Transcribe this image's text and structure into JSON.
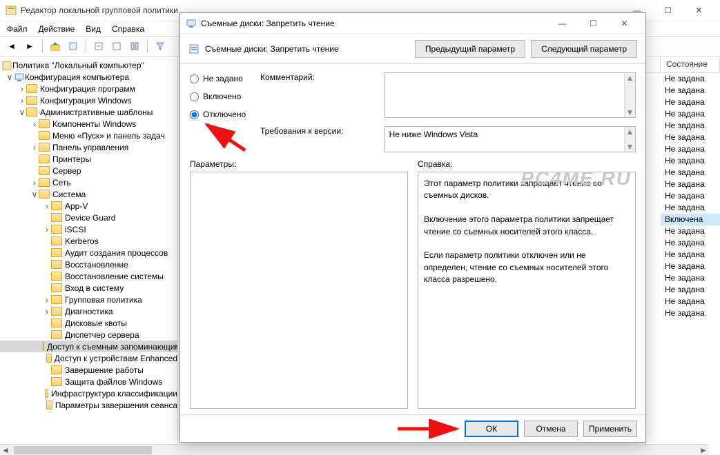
{
  "main_window": {
    "title": "Редактор локальной групповой политики"
  },
  "menubar": {
    "file": "Файл",
    "action": "Действие",
    "view": "Вид",
    "help": "Справка"
  },
  "tree": {
    "root": "Политика \"Локальный компьютер\"",
    "computer_cfg": "Конфигурация компьютера",
    "sw_cfg": "Конфигурация программ",
    "win_cfg": "Конфигурация Windows",
    "adm_tmpl": "Административные шаблоны",
    "win_comp": "Компоненты Windows",
    "start_task": "Меню «Пуск» и панель задач",
    "ctrl_panel": "Панель управления",
    "printers": "Принтеры",
    "server": "Сервер",
    "network": "Сеть",
    "system": "Система",
    "appv": "App-V",
    "devguard": "Device Guard",
    "iscsi": "iSCSI",
    "kerberos": "Kerberos",
    "proc_audit": "Аудит создания процессов",
    "recovery": "Восстановление",
    "sys_restore": "Восстановление системы",
    "logon": "Вход в систему",
    "gp": "Групповая политика",
    "diag": "Диагностика",
    "disk_quota": "Дисковые квоты",
    "srv_mgr": "Диспетчер сервера",
    "removable": "Доступ к съемным запоминающим",
    "enh_dev": "Доступ к устройствам Enhanced",
    "shutdown": "Завершение работы",
    "wfp": "Защита файлов Windows",
    "infra": "Инфраструктура классификации",
    "shutdown_params": "Параметры завершения сеанса"
  },
  "grid": {
    "state_header": "Состояние",
    "states": [
      "Не задана",
      "Не задана",
      "Не задана",
      "Не задана",
      "Не задана",
      "Не задана",
      "Не задана",
      "Не задана",
      "Не задана",
      "Не задана",
      "Не задана",
      "Не задана",
      "Включена",
      "Не задана",
      "Не задана",
      "Не задана",
      "Не задана",
      "Не задана",
      "Не задана",
      "Не задана",
      "Не задана"
    ],
    "selected_index": 12
  },
  "dialog": {
    "window_title": "Съемные диски: Запретить чтение",
    "header_title": "Съемные диски: Запретить чтение",
    "prev_btn": "Предыдущий параметр",
    "next_btn": "Следующий параметр",
    "radio_notset": "Не задано",
    "radio_enabled": "Включено",
    "radio_disabled": "Отключено",
    "comment_label": "Комментарий:",
    "requirements_label": "Требования к версии:",
    "requirements_value": "Не ниже Windows Vista",
    "params_label": "Параметры:",
    "help_label": "Справка:",
    "help_text_p1": "Этот параметр политики запрещает чтение со съемных дисков.",
    "help_text_p2": "Включение этого параметра политики запрещает чтение со съемных носителей этого класса.",
    "help_text_p3": "Если параметр политики отключен или не определен, чтение со съемных носителей этого класса разрешено.",
    "ok": "ОК",
    "cancel": "Отмена",
    "apply": "Применить"
  },
  "watermark": "PC4ME.RU"
}
